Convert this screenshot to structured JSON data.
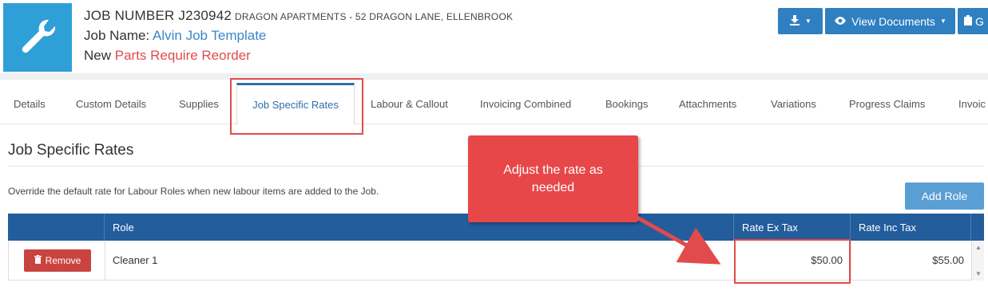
{
  "header": {
    "job_number": "JOB NUMBER J230942",
    "address": "DRAGON APARTMENTS - 52 DRAGON LANE, ELLENBROOK",
    "job_name_label": "Job Name:",
    "job_name_value": "Alvin Job Template",
    "status_label": "New",
    "status_value": "Parts Require Reorder",
    "logo_icon": "wrench-icon",
    "buttons": {
      "download_icon": "download-icon",
      "view_documents": "View Documents",
      "third_button_text": "G"
    }
  },
  "tabs": [
    {
      "label": "Details"
    },
    {
      "label": "Custom Details"
    },
    {
      "label": "Supplies"
    },
    {
      "label": "Job Specific Rates",
      "active": true
    },
    {
      "label": "Labour & Callout"
    },
    {
      "label": "Invoicing Combined"
    },
    {
      "label": "Bookings"
    },
    {
      "label": "Attachments"
    },
    {
      "label": "Variations"
    },
    {
      "label": "Progress Claims"
    },
    {
      "label": "Invoic"
    }
  ],
  "section": {
    "title": "Job Specific Rates",
    "description": "Override the default rate for Labour Roles when new labour items are added to the Job.",
    "add_role_label": "Add Role"
  },
  "table": {
    "columns": [
      "",
      "Role",
      "Rate Ex Tax",
      "Rate Inc Tax"
    ],
    "rows": [
      {
        "action": "Remove",
        "role": "Cleaner 1",
        "rate_ex_tax": "$50.00",
        "rate_inc_tax": "$55.00"
      }
    ]
  },
  "callout": {
    "text": "Adjust the rate as needed"
  },
  "colors": {
    "accent": "#2f7fc1",
    "header_table": "#235d9c",
    "danger": "#c9433f",
    "annotation": "#e24b4b",
    "logo_bg": "#2f9fd8"
  }
}
